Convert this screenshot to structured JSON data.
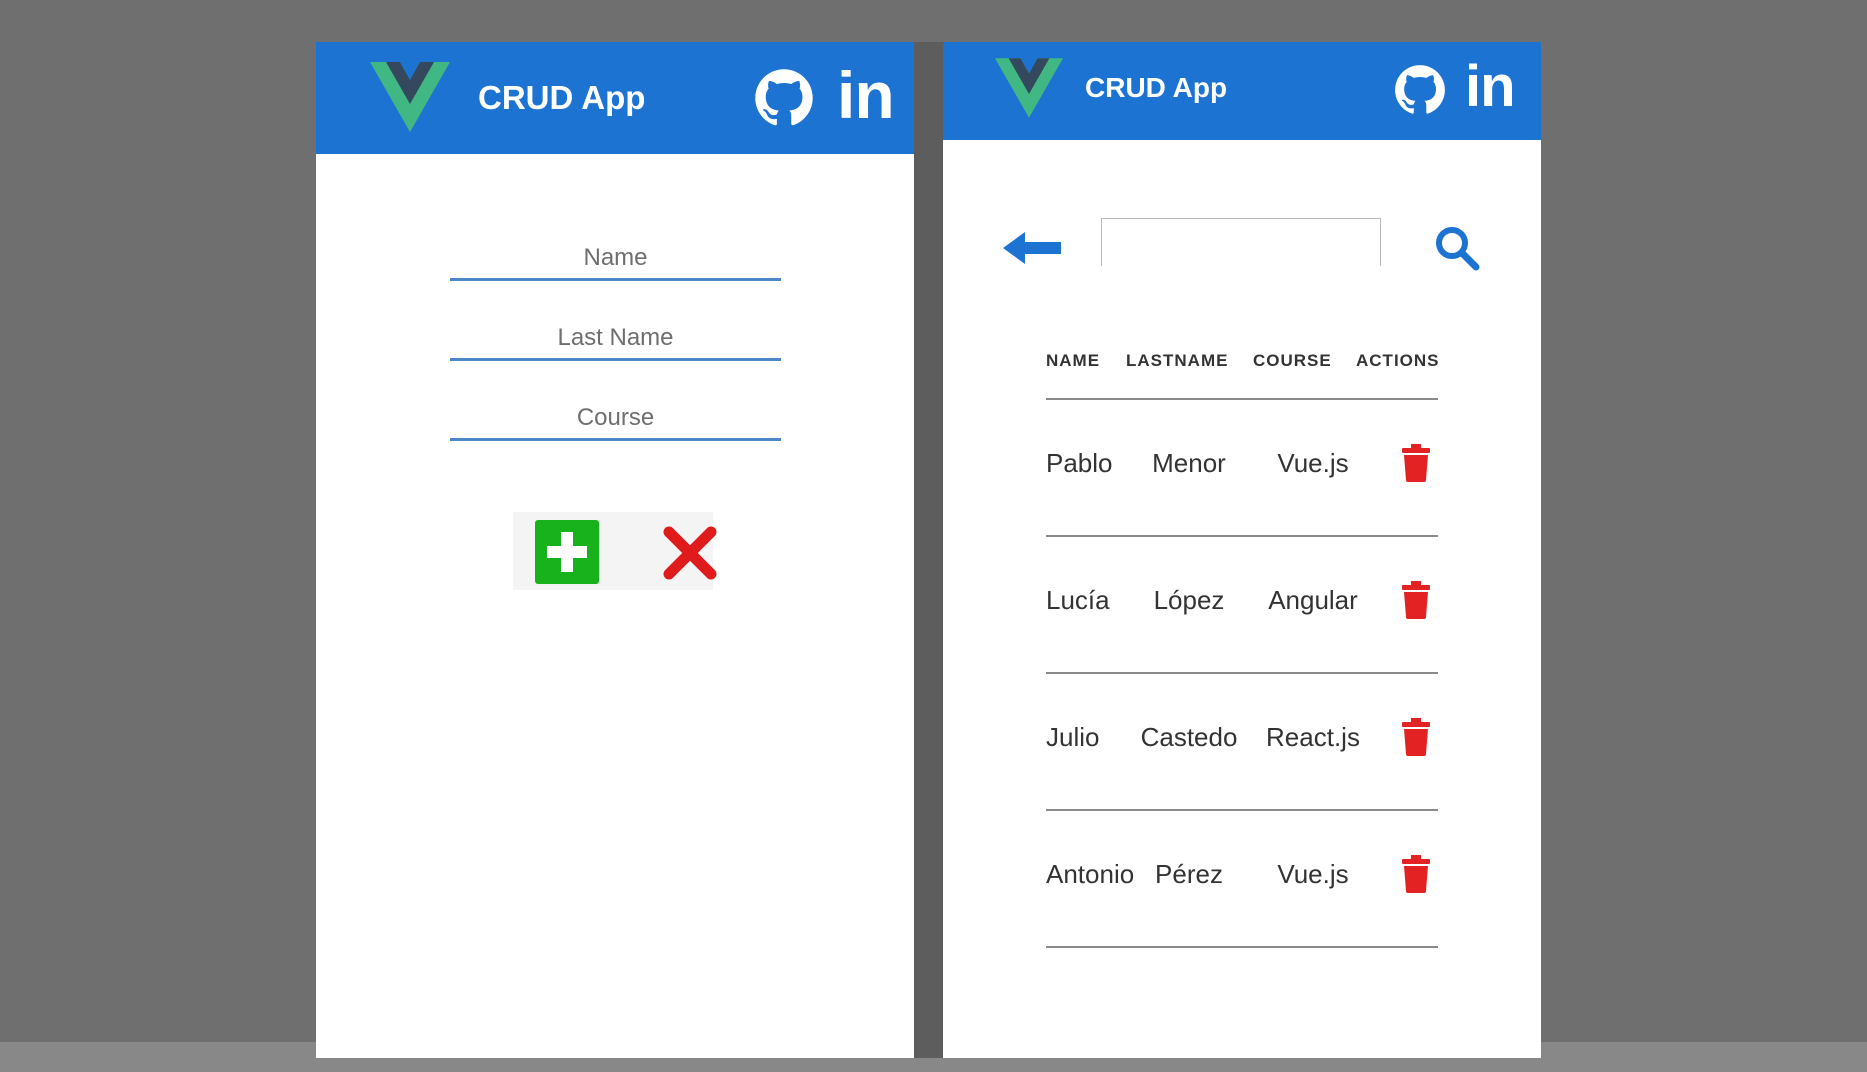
{
  "colors": {
    "header": "#1c73d2",
    "background": "#6f6f6f",
    "add_button": "#17b21c",
    "cancel_icon": "#e01b1b",
    "delete_icon": "#e32323",
    "vue_green": "#41b883",
    "vue_dark": "#34495e"
  },
  "icons": {
    "logo": "vue-logo",
    "github": "github-icon",
    "linkedin": "linkedin-icon",
    "add": "plus-icon",
    "cancel": "x-icon",
    "back": "arrow-left-icon",
    "search": "magnifier-icon",
    "delete": "trash-icon"
  },
  "header": {
    "title": "CRUD App",
    "linkedin_label": "in"
  },
  "form": {
    "name_placeholder": "Name",
    "lastname_placeholder": "Last Name",
    "course_placeholder": "Course"
  },
  "list": {
    "search_value": "",
    "columns": [
      "NAME",
      "LASTNAME",
      "COURSE",
      "ACTIONS"
    ],
    "rows": [
      {
        "name": "Pablo",
        "lastname": "Menor",
        "course": "Vue.js"
      },
      {
        "name": "Lucía",
        "lastname": "López",
        "course": "Angular"
      },
      {
        "name": "Julio",
        "lastname": "Castedo",
        "course": "React.js"
      },
      {
        "name": "Antonio",
        "lastname": "Pérez",
        "course": "Vue.js"
      }
    ]
  }
}
